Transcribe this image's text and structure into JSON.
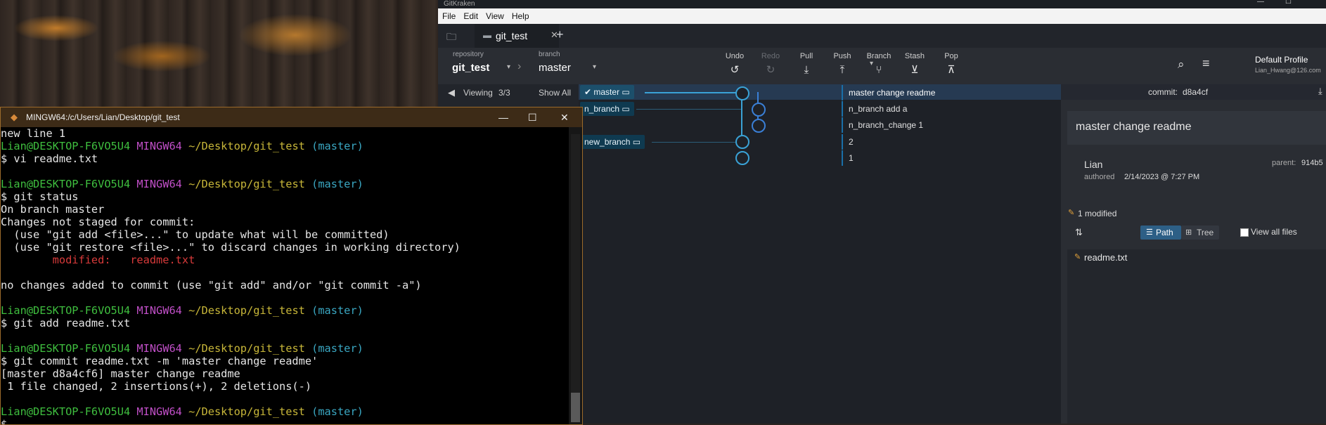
{
  "gitkraken": {
    "window_title": "GitKraken",
    "menu": [
      "File",
      "Edit",
      "View",
      "Help"
    ],
    "tab": {
      "label": "git_test"
    },
    "toolbar": {
      "repository_label": "repository",
      "repository_value": "git_test",
      "branch_label": "branch",
      "branch_value": "master",
      "buttons": {
        "undo": "Undo",
        "redo": "Redo",
        "pull": "Pull",
        "push": "Push",
        "branch": "Branch",
        "stash": "Stash",
        "pop": "Pop"
      },
      "profile_name": "Default Profile",
      "profile_email": "Lian_Hwang@126.com"
    },
    "sidebar": {
      "viewing": "Viewing",
      "count": "3/3",
      "show_all": "Show All"
    },
    "graph": {
      "refs": [
        "master",
        "n_branch",
        "new_branch"
      ],
      "commits": [
        "master change readme",
        "n_branch add a",
        "n_branch_change 1",
        "2",
        "1"
      ]
    },
    "commit_panel": {
      "commit_label": "commit:",
      "commit_sha": "d8a4cf",
      "message": "master change readme",
      "author": "Lian",
      "authored_label": "authored",
      "authored_date": "2/14/2023 @ 7:27 PM",
      "parent_label": "parent:",
      "parent_sha": "914b5",
      "modified_count": "1 modified",
      "path_label": "Path",
      "tree_label": "Tree",
      "view_all_files": "View all files",
      "files": [
        "readme.txt"
      ]
    }
  },
  "terminal": {
    "title": "MINGW64:/c/Users/Lian/Desktop/git_test",
    "prompt": {
      "user": "Lian@DESKTOP-F6VO5U4",
      "env": "MINGW64",
      "path": "~/Desktop/git_test",
      "branch": "(master)"
    },
    "lines": {
      "l0": "new line 1",
      "l1": "$ vi readme.txt",
      "l2": "$ git status",
      "l3": "On branch master",
      "l4": "Changes not staged for commit:",
      "l5": "  (use \"git add <file>...\" to update what will be committed)",
      "l6": "  (use \"git restore <file>...\" to discard changes in working directory)",
      "l7_label": "        modified:   ",
      "l7_file": "readme.txt",
      "l8": "no changes added to commit (use \"git add\" and/or \"git commit -a\")",
      "l9": "$ git add readme.txt",
      "l10": "$ git commit readme.txt -m 'master change readme'",
      "l11": "[master d8a4cf6] master change readme",
      "l12": " 1 file changed, 2 insertions(+), 2 deletions(-)",
      "l13": "$ "
    }
  }
}
